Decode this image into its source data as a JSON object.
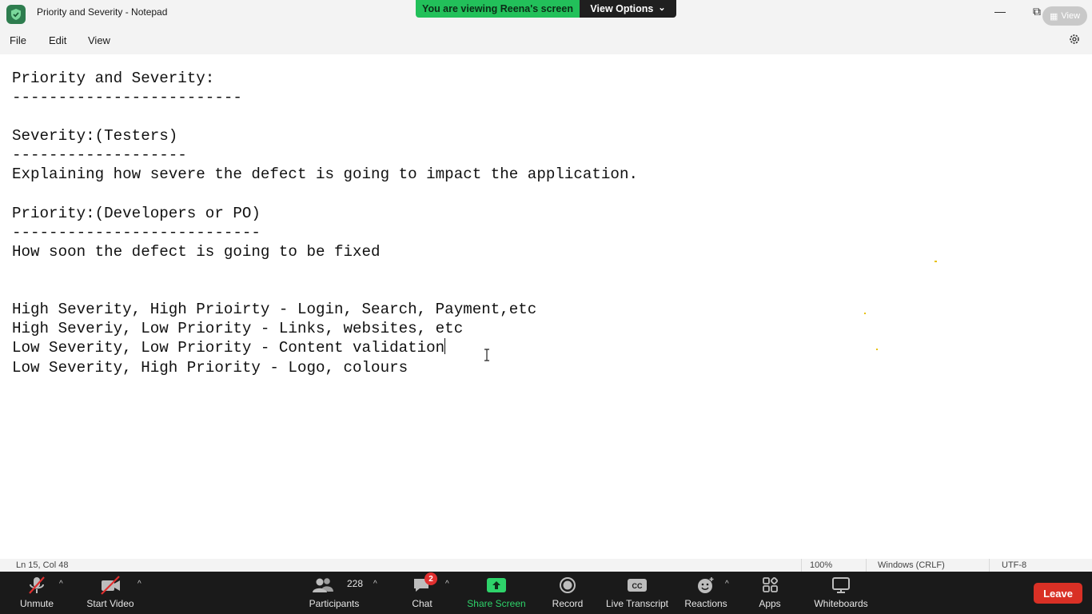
{
  "window": {
    "title": "Priority and Severity - Notepad",
    "minimize_glyph": "—",
    "restore_glyph": "⧉",
    "close_glyph": "✕",
    "view_label": "View"
  },
  "share_banner": {
    "viewing_text": "You are viewing Reena's screen",
    "options_label": "View Options",
    "options_chevron": "⌄"
  },
  "menu": {
    "file": "File",
    "edit": "Edit",
    "view": "View"
  },
  "editor": {
    "lines": [
      "Priority and Severity:",
      "-------------------------",
      "",
      "Severity:(Testers)",
      "-------------------",
      "Explaining how severe the defect is going to impact the application.",
      "",
      "Priority:(Developers or PO)",
      "---------------------------",
      "How soon the defect is going to be fixed",
      "",
      "",
      "High Severity, High Prioirty - Login, Search, Payment,etc",
      "High Severiy, Low Priority - Links, websites, etc",
      "Low Severity, Low Priority - Content validation",
      "Low Severity, High Priority - Logo, colours"
    ]
  },
  "statusbar": {
    "position": "Ln 15, Col 48",
    "zoom": "100%",
    "line_ending": "Windows (CRLF)",
    "encoding": "UTF-8"
  },
  "zoom_controls": {
    "unmute": "Unmute",
    "start_video": "Start Video",
    "participants": "Participants",
    "participants_count": "228",
    "chat": "Chat",
    "chat_badge": "2",
    "share_screen": "Share Screen",
    "record": "Record",
    "live_transcript": "Live Transcript",
    "reactions": "Reactions",
    "apps": "Apps",
    "whiteboards": "Whiteboards",
    "leave": "Leave",
    "caret": "^"
  },
  "colors": {
    "banner_green": "#22c05a",
    "leave_red": "#d93025",
    "share_green": "#2ed36a"
  }
}
